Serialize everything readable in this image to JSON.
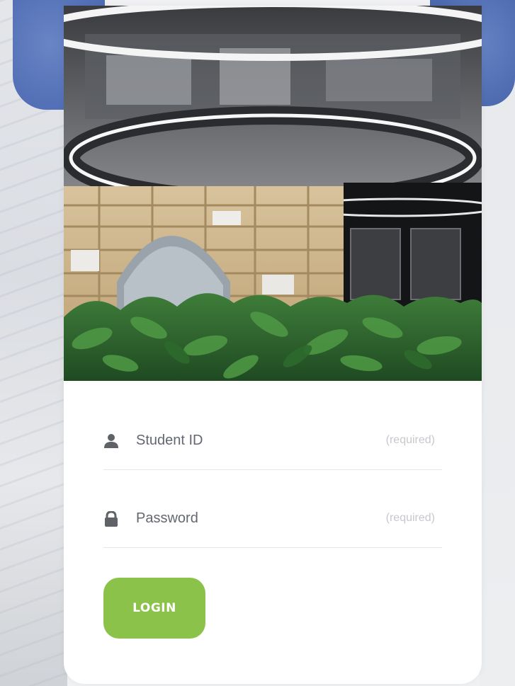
{
  "form": {
    "student_id": {
      "label": "Student ID",
      "hint": "(required)",
      "icon": "user-icon"
    },
    "password": {
      "label": "Password",
      "hint": "(required)",
      "icon": "lock-icon"
    },
    "login_label": "LOGIN"
  },
  "colors": {
    "accent_green": "#8bc34a",
    "blob_blue": "#5572b8",
    "card_bg": "#ffffff",
    "text_muted": "#636770",
    "hint_text": "#c5c8cd"
  }
}
